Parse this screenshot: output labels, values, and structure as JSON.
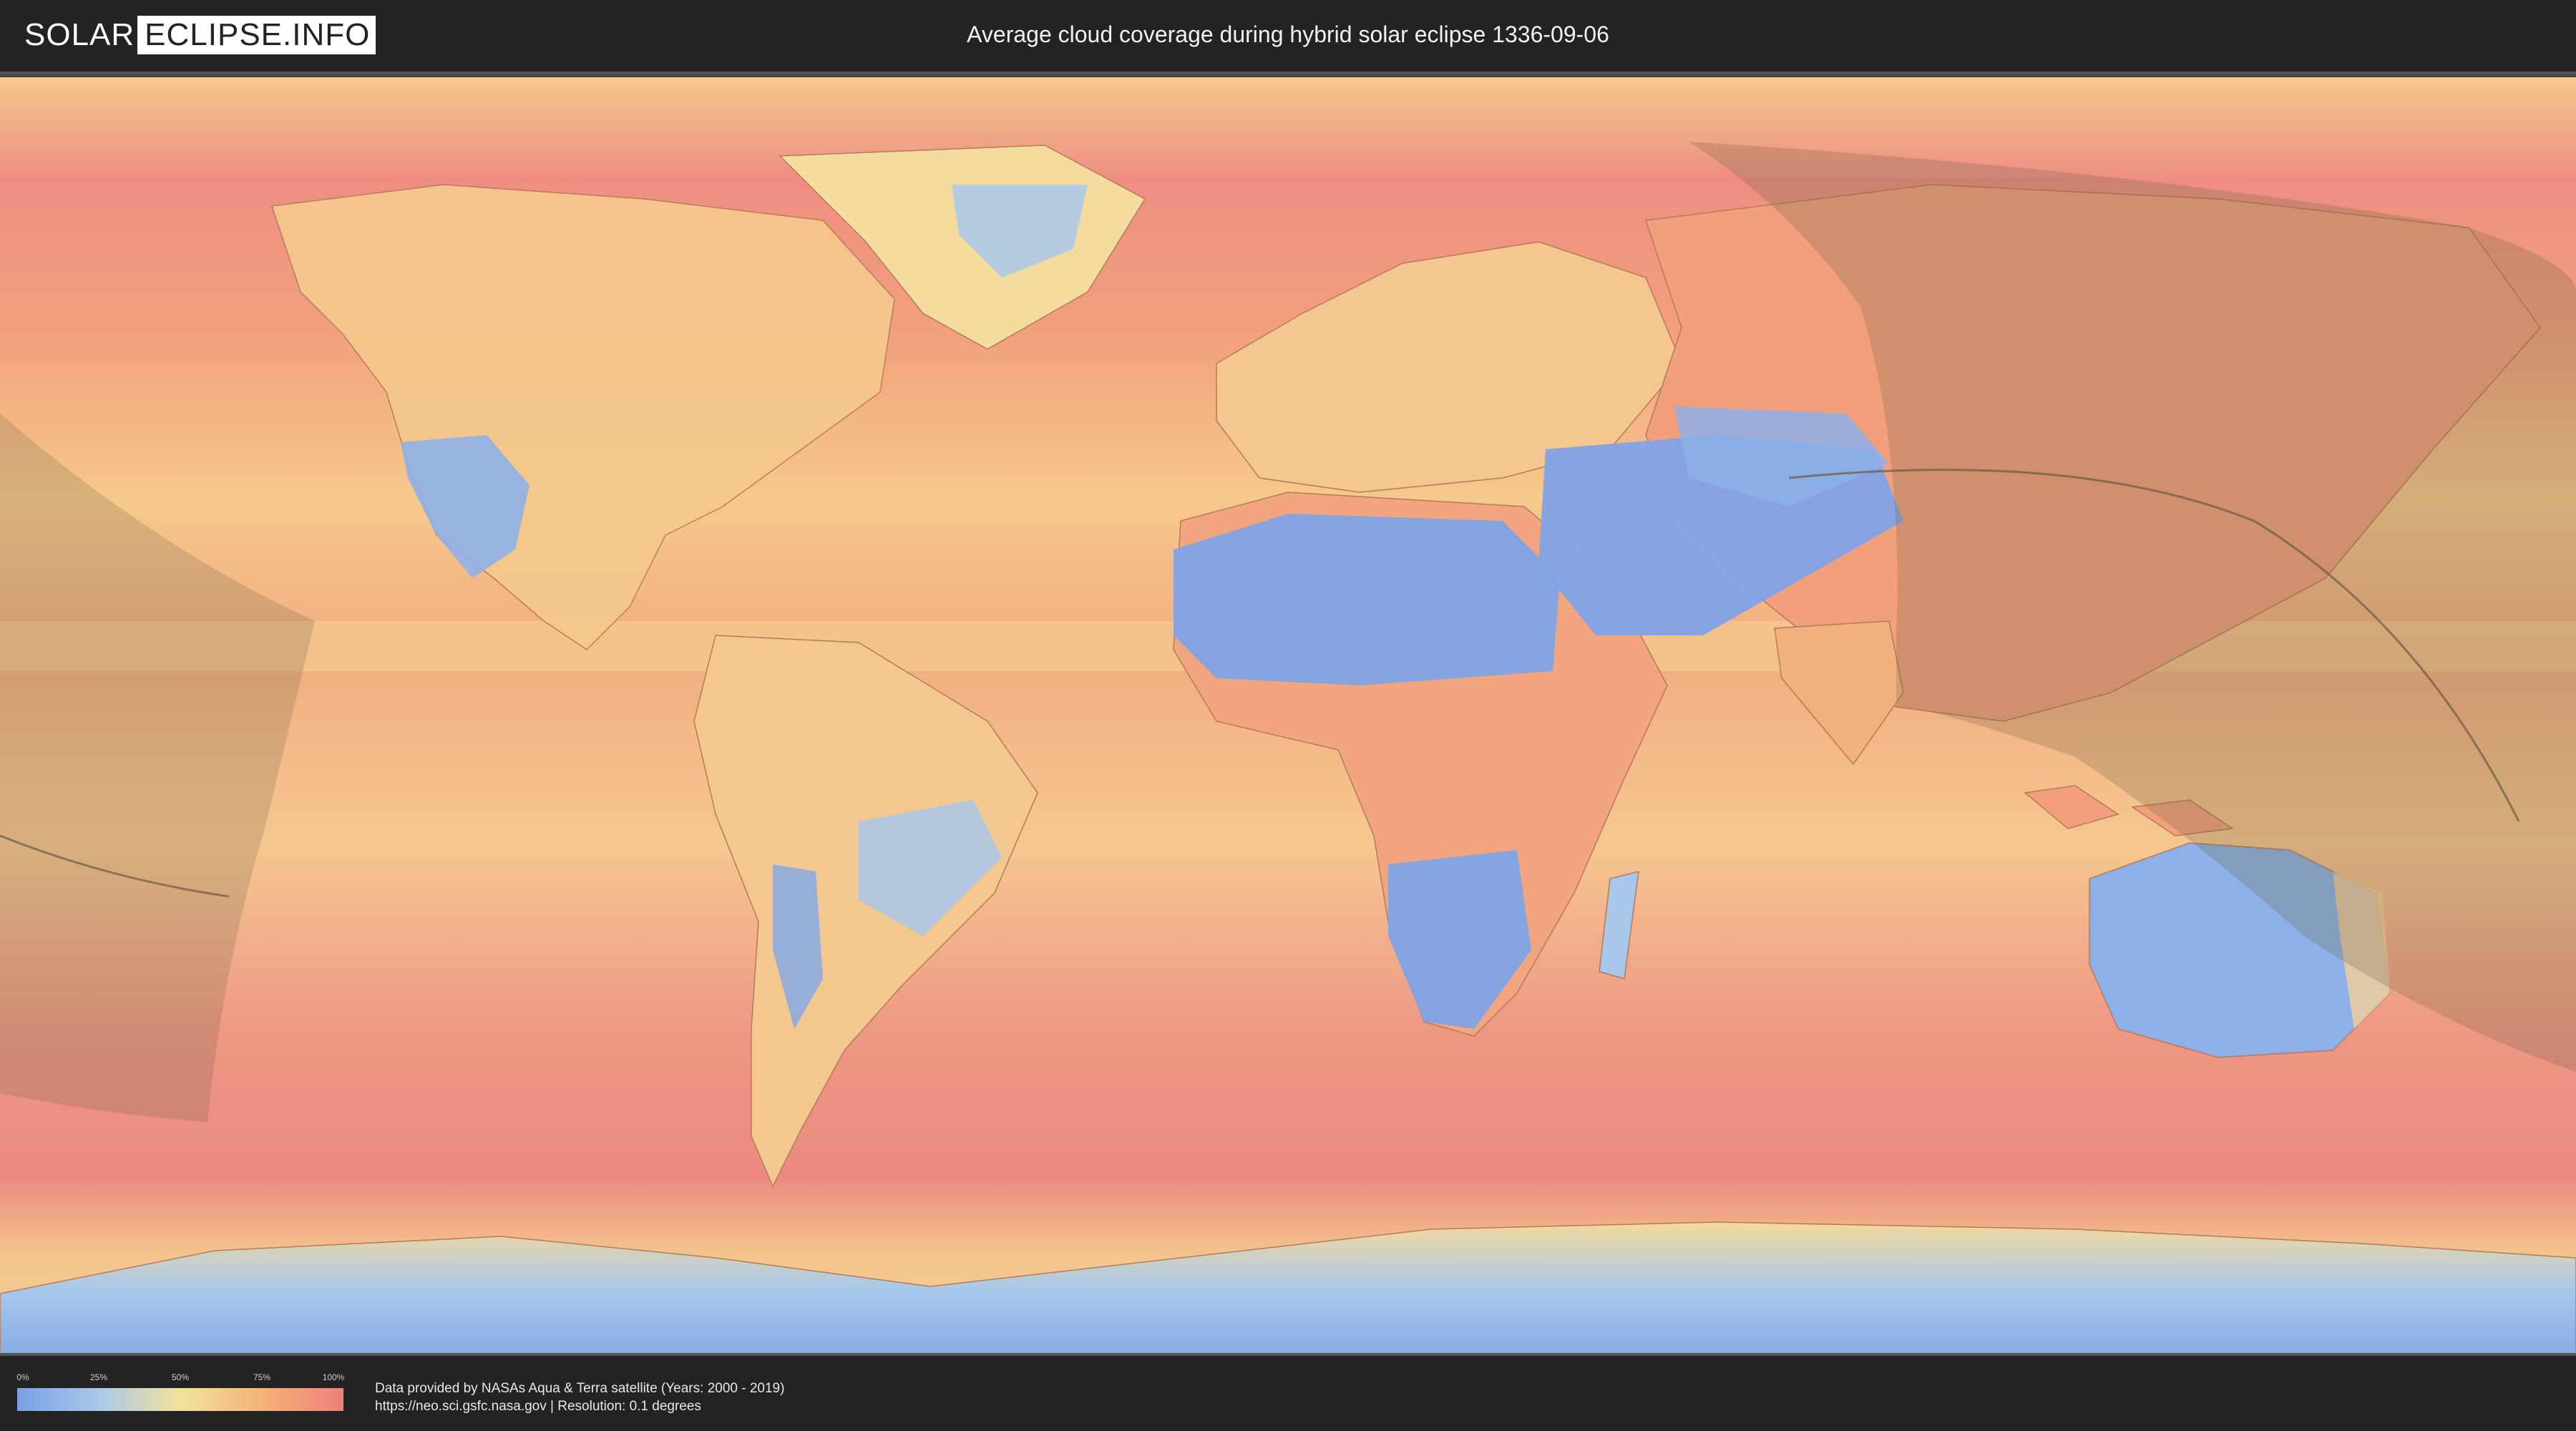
{
  "header": {
    "logo_left": "SOLAR",
    "logo_right": "ECLIPSE.INFO",
    "title": "Average cloud coverage during hybrid solar eclipse 1336-09-06"
  },
  "map": {
    "type": "equirectangular world cloud-coverage map",
    "eclipse_shadow_overlays": [
      {
        "description": "translucent shadow region at far west (Pacific), left edge"
      },
      {
        "description": "translucent shadow region over Asia, Indian Ocean and Australia, right side"
      }
    ],
    "path_line": "thin dark central eclipse path line crossing Asia and Pacific",
    "colors": {
      "low": "#7a9fe6",
      "mid": "#f3e29b",
      "high": "#ee7f7b"
    }
  },
  "legend": {
    "ticks": [
      "0%",
      "25%",
      "50%",
      "75%",
      "100%"
    ],
    "colors": [
      "#7a9fe6",
      "#a9c9e9",
      "#f3e29b",
      "#f5b378",
      "#ee7f7b"
    ]
  },
  "credits": {
    "line1": "Data provided by NASAs Aqua & Terra satellite (Years: 2000 - 2019)",
    "line2": "https://neo.sci.gsfc.nasa.gov | Resolution: 0.1 degrees"
  }
}
